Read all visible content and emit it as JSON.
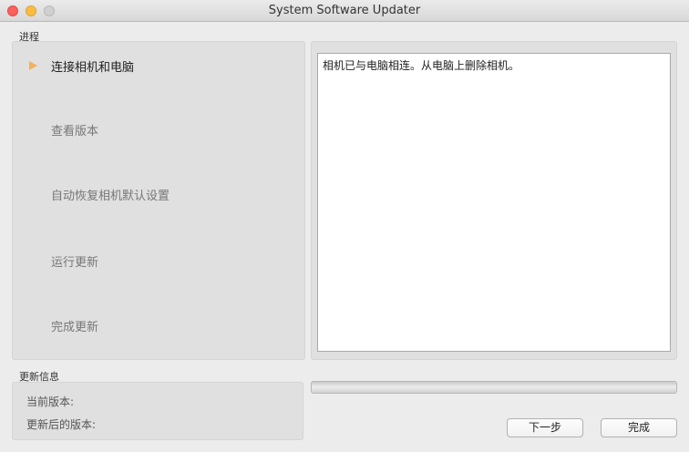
{
  "window": {
    "title": "System Software Updater"
  },
  "progress_section": {
    "label": "进程",
    "steps": [
      {
        "label": "连接相机和电脑",
        "active": true
      },
      {
        "label": "查看版本",
        "active": false
      },
      {
        "label": "自动恢复相机默认设置",
        "active": false
      },
      {
        "label": "运行更新",
        "active": false
      },
      {
        "label": "完成更新",
        "active": false
      }
    ]
  },
  "message": {
    "text": "相机已与电脑相连。从电脑上删除相机。"
  },
  "update_info": {
    "label": "更新信息",
    "current_version_label": "当前版本:",
    "updated_version_label": "更新后的版本:"
  },
  "progress_bar": {
    "fraction": 0
  },
  "buttons": {
    "next": "下一步",
    "done": "完成"
  },
  "colors": {
    "active_arrow": "#f3b15a",
    "close": "#fc605c",
    "minimize": "#fdbc40",
    "maximize_disabled": "#d0d0d0"
  }
}
